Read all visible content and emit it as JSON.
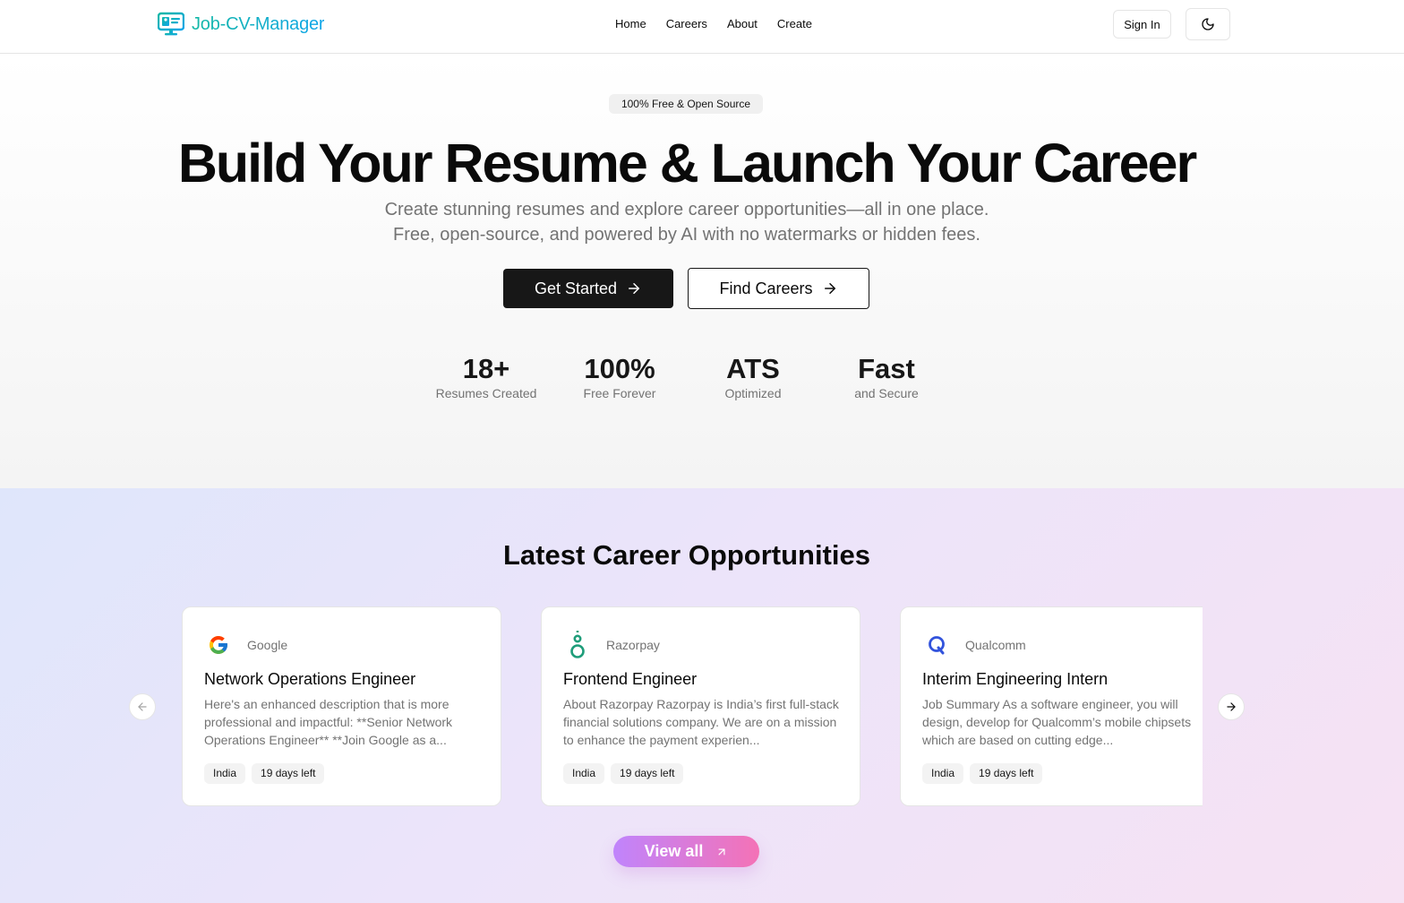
{
  "header": {
    "brand": "Job-CV-Manager",
    "brand_icon": "monitor-resume-icon",
    "nav": [
      "Home",
      "Careers",
      "About",
      "Create"
    ],
    "sign_in": "Sign In",
    "theme_icon": "moon-icon"
  },
  "hero": {
    "badge": "100% Free & Open Source",
    "title": "Build Your Resume & Launch Your Career",
    "subtitle_line1": "Create stunning resumes and explore career opportunities—all in one place.",
    "subtitle_line2": "Free, open-source, and powered by AI with no watermarks or hidden fees.",
    "primary_cta": "Get Started",
    "secondary_cta": "Find Careers",
    "stats": [
      {
        "value": "18+",
        "label": "Resumes Created"
      },
      {
        "value": "100%",
        "label": "Free Forever"
      },
      {
        "value": "ATS",
        "label": "Optimized"
      },
      {
        "value": "Fast",
        "label": "and Secure"
      }
    ]
  },
  "careers": {
    "title": "Latest Career Opportunities",
    "jobs": [
      {
        "company": "Google",
        "logo": "google-logo-icon",
        "title": "Network Operations Engineer",
        "description": "Here's an enhanced description that is more professional and impactful: **Senior Network Operations Engineer** **Join Google as a...",
        "location": "India",
        "deadline": "19 days left"
      },
      {
        "company": "Razorpay",
        "logo": "razorpay-logo-icon",
        "title": "Frontend Engineer",
        "description": "About Razorpay Razorpay is India’s first full-stack financial solutions company. We are on a mission to enhance the payment experien...",
        "location": "India",
        "deadline": "19 days left"
      },
      {
        "company": "Qualcomm",
        "logo": "qualcomm-logo-icon",
        "title": "Interim Engineering Intern",
        "description": "Job Summary As a software engineer, you will design, develop for Qualcomm’s mobile chipsets which are based on cutting edge...",
        "location": "India",
        "deadline": "19 days left"
      }
    ],
    "view_all": "View all"
  },
  "colors": {
    "brand_gradient_start": "#14b8a6",
    "brand_gradient_end": "#0ea5e9",
    "primary_button": "#171717",
    "view_all_gradient_start": "#c084fc",
    "view_all_gradient_end": "#f472b6"
  }
}
